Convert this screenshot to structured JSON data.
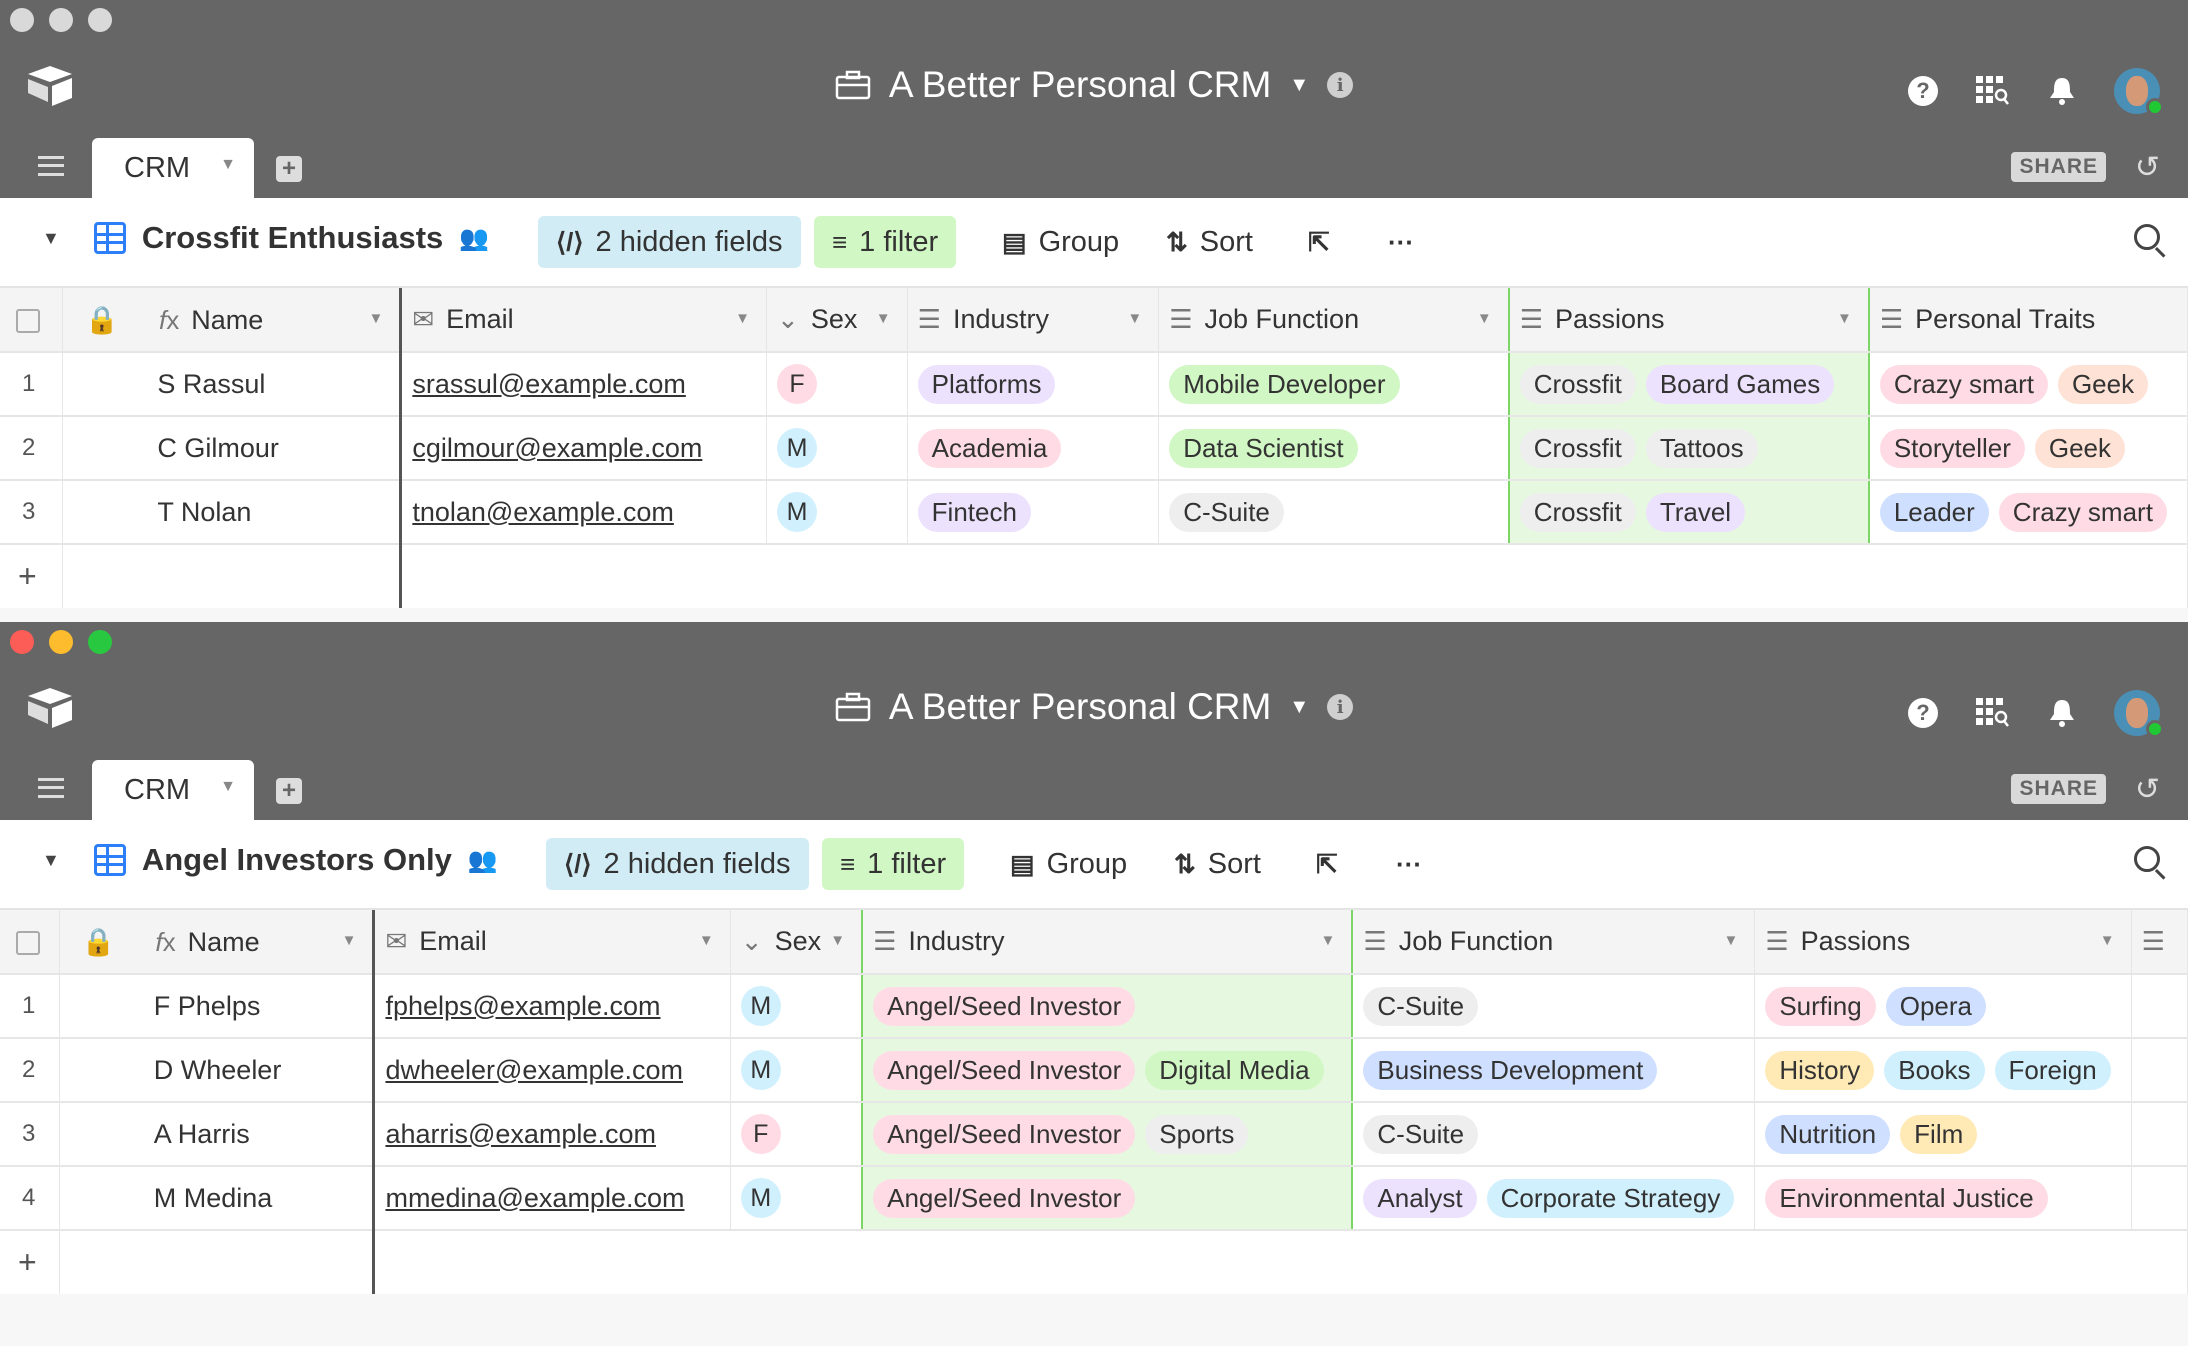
{
  "app": {
    "base_title": "A Better Personal CRM",
    "share_label": "SHARE",
    "table_tab": "CRM",
    "help": "?"
  },
  "windows": [
    {
      "view_name": "Crossfit Enthusiasts",
      "toolbar": {
        "hidden_fields": "2 hidden fields",
        "filter": "1 filter",
        "group": "Group",
        "sort": "Sort"
      },
      "columns": [
        "Name",
        "Email",
        "Sex",
        "Industry",
        "Job Function",
        "Passions",
        "Personal Traits"
      ],
      "rows": [
        {
          "num": "1",
          "name": "S Rassul",
          "email": "srassul@example.com",
          "sex": "F",
          "industry": [
            "Platforms"
          ],
          "job": [
            "Mobile Developer"
          ],
          "passions": [
            "Crossfit",
            "Board Games"
          ],
          "traits": [
            "Crazy smart",
            "Geek"
          ]
        },
        {
          "num": "2",
          "name": "C Gilmour",
          "email": "cgilmour@example.com",
          "sex": "M",
          "industry": [
            "Academia"
          ],
          "job": [
            "Data Scientist"
          ],
          "passions": [
            "Crossfit",
            "Tattoos"
          ],
          "traits": [
            "Storyteller",
            "Geek"
          ]
        },
        {
          "num": "3",
          "name": "T Nolan",
          "email": "tnolan@example.com",
          "sex": "M",
          "industry": [
            "Fintech"
          ],
          "job": [
            "C-Suite"
          ],
          "passions": [
            "Crossfit",
            "Travel"
          ],
          "traits": [
            "Leader",
            "Crazy smart"
          ]
        }
      ]
    },
    {
      "view_name": "Angel Investors Only",
      "toolbar": {
        "hidden_fields": "2 hidden fields",
        "filter": "1 filter",
        "group": "Group",
        "sort": "Sort"
      },
      "columns": [
        "Name",
        "Email",
        "Sex",
        "Industry",
        "Job Function",
        "Passions"
      ],
      "rows": [
        {
          "num": "1",
          "name": "F Phelps",
          "email": "fphelps@example.com",
          "sex": "M",
          "industry": [
            "Angel/Seed Investor"
          ],
          "job": [
            "C-Suite"
          ],
          "passions": [
            "Surfing",
            "Opera"
          ]
        },
        {
          "num": "2",
          "name": "D Wheeler",
          "email": "dwheeler@example.com",
          "sex": "M",
          "industry": [
            "Angel/Seed Investor",
            "Digital Media"
          ],
          "job": [
            "Business Development"
          ],
          "passions": [
            "History",
            "Books",
            "Foreign"
          ]
        },
        {
          "num": "3",
          "name": "A Harris",
          "email": "aharris@example.com",
          "sex": "F",
          "industry": [
            "Angel/Seed Investor",
            "Sports"
          ],
          "job": [
            "C-Suite"
          ],
          "passions": [
            "Nutrition",
            "Film"
          ]
        },
        {
          "num": "4",
          "name": "M Medina",
          "email": "mmedina@example.com",
          "sex": "M",
          "industry": [
            "Angel/Seed Investor"
          ],
          "job": [
            "Analyst",
            "Corporate Strategy"
          ],
          "passions": [
            "Environmental Justice"
          ]
        }
      ]
    }
  ],
  "icons": [
    "logo-icon",
    "briefcase-icon",
    "info-icon",
    "help-icon",
    "apps-icon",
    "bell-icon",
    "avatar",
    "menu-icon",
    "add-table-icon",
    "history-icon",
    "grid-view-icon",
    "collaborators-icon",
    "hidden-fields-icon",
    "filter-icon",
    "group-icon",
    "sort-icon",
    "share-view-icon",
    "more-icon",
    "search-icon"
  ]
}
